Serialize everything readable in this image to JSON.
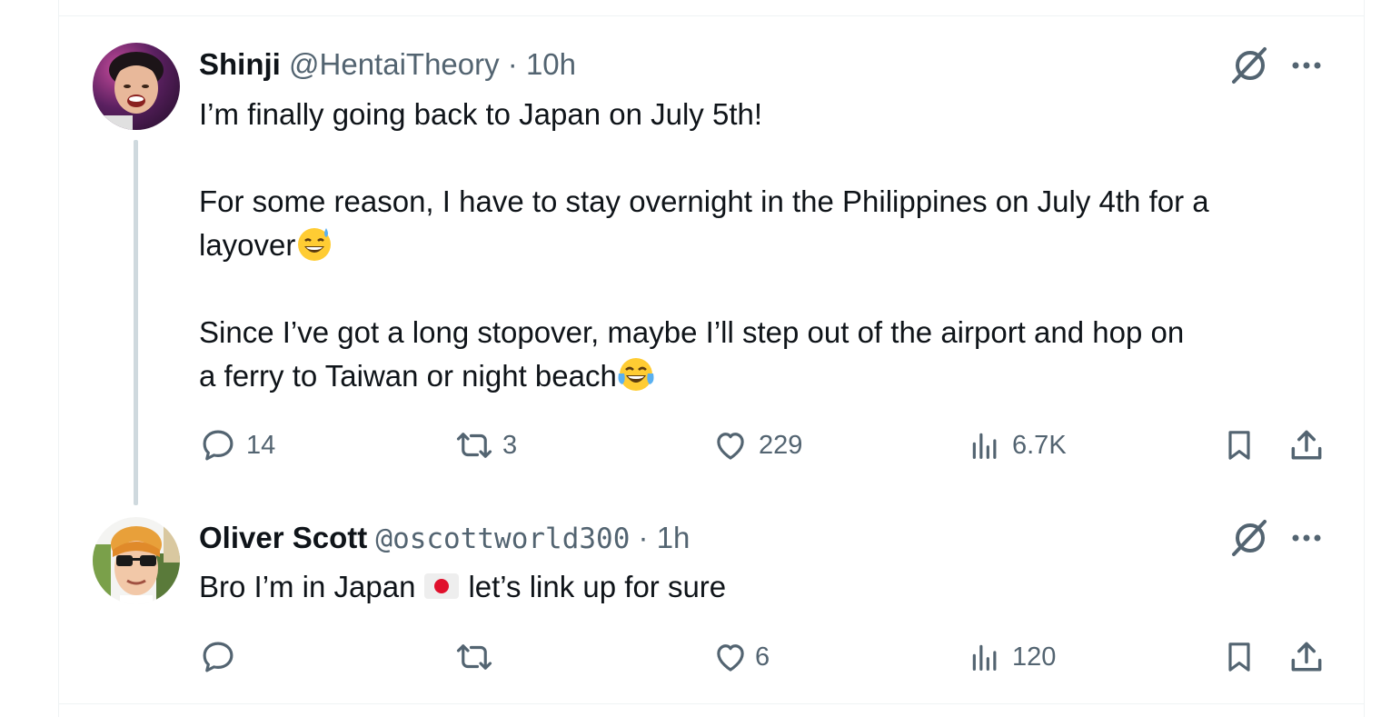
{
  "tweets": [
    {
      "name": "Shinji",
      "handle": "@HentaiTheory",
      "separator": " · ",
      "time": "10h",
      "text_line1": "I’m finally going back to Japan on July 5th!",
      "text_line2a": "For some reason, I have to stay overnight in the Philippines on July 4th for a",
      "text_line2b": "layover",
      "text_line3a": "Since I’ve got a long stopover, maybe I’ll step out of the airport and hop on",
      "text_line3b": "a ferry to Taiwan or night beach",
      "replies": "14",
      "reposts": "3",
      "likes": "229",
      "views": "6.7K"
    },
    {
      "name": "Oliver Scott",
      "handle": "@oscottworld300",
      "separator": " · ",
      "time": "1h",
      "text_a": "Bro I’m in Japan",
      "text_b": "let’s link up for sure",
      "replies": "",
      "reposts": "",
      "likes": "6",
      "views": "120"
    }
  ],
  "icons": {
    "reply": "reply-icon",
    "repost": "repost-icon",
    "like": "heart-icon",
    "views": "views-icon",
    "bookmark": "bookmark-icon",
    "share": "share-icon",
    "grok": "grok-icon",
    "more": "more-icon"
  },
  "colors": {
    "text": "#0f1419",
    "secondary": "#536471",
    "thread_line": "#cfd9de",
    "divider": "#eff3f4"
  }
}
